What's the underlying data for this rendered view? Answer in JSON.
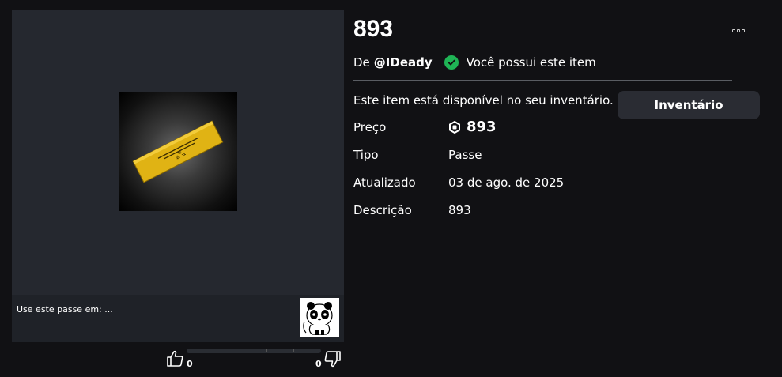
{
  "item": {
    "title": "893",
    "by_prefix": "De",
    "creator": "@IDeady",
    "owned_text": "Você possui este item",
    "availability": "Este item está disponível no seu inventário.",
    "inventory_button": "Inventário"
  },
  "details": {
    "price_label": "Preço",
    "price_value": "893",
    "type_label": "Tipo",
    "type_value": "Passe",
    "updated_label": "Atualizado",
    "updated_value": "03 de ago. de 2025",
    "description_label": "Descrição",
    "description_value": "893"
  },
  "use_in": {
    "label": "Use este passe em: ..."
  },
  "votes": {
    "up": "0",
    "down": "0"
  },
  "icons": {
    "owned": "check-circle-icon",
    "currency": "robux-icon",
    "more": "more-options-icon",
    "thumb_up": "thumbs-up-icon",
    "thumb_down": "thumbs-down-icon"
  },
  "colors": {
    "background": "#111114",
    "panel": "#25282f",
    "owned_green": "#1fb455",
    "button": "#2a2c33",
    "pass_gold": "#e0b314"
  }
}
